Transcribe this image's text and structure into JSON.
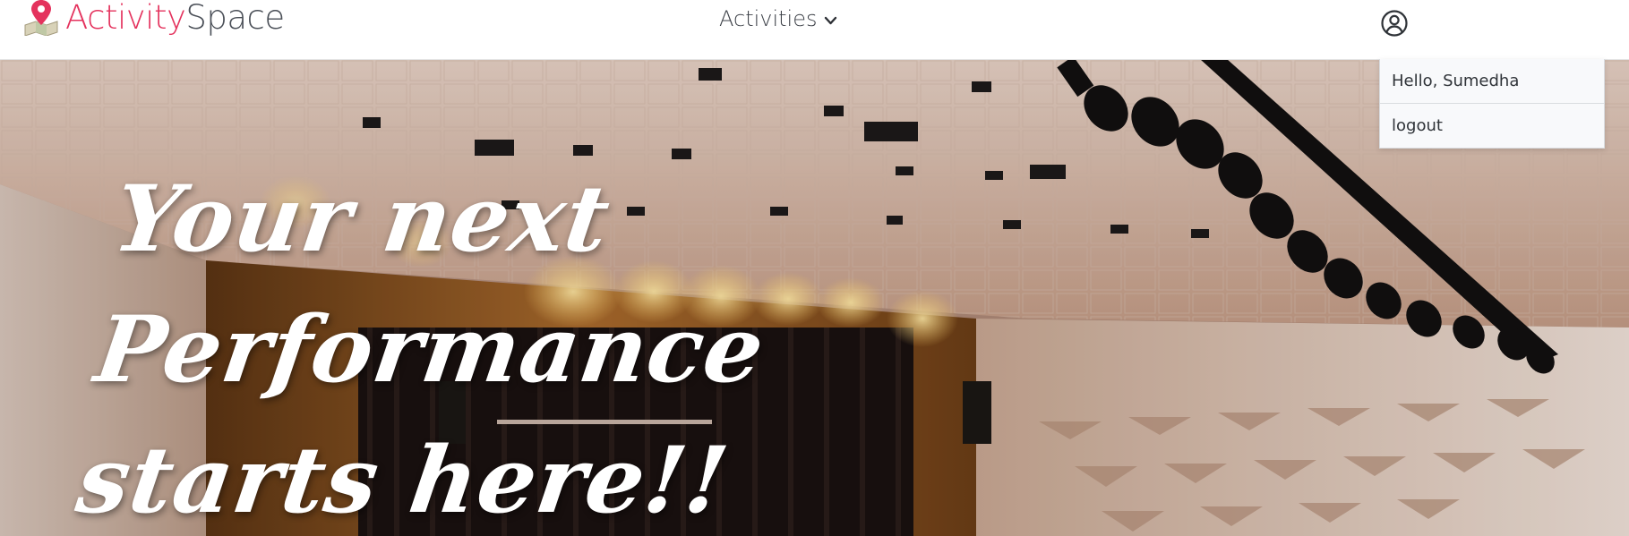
{
  "brand": {
    "name_part1": "Activity",
    "name_part2": "Space",
    "logo_icon": "map-pin-icon",
    "color_part1": "#e4325d",
    "color_part2": "#4a4f57"
  },
  "nav": {
    "activities_label": "Activities",
    "activities_icon": "chevron-down-icon",
    "user_icon": "user-circle-icon"
  },
  "user_menu": {
    "greeting": "Hello, Sumedha",
    "logout_label": "logout"
  },
  "hero": {
    "title_line1": "Your next Performance",
    "title_line2": "starts here!!",
    "background_description": "auditorium-stage-photo"
  }
}
